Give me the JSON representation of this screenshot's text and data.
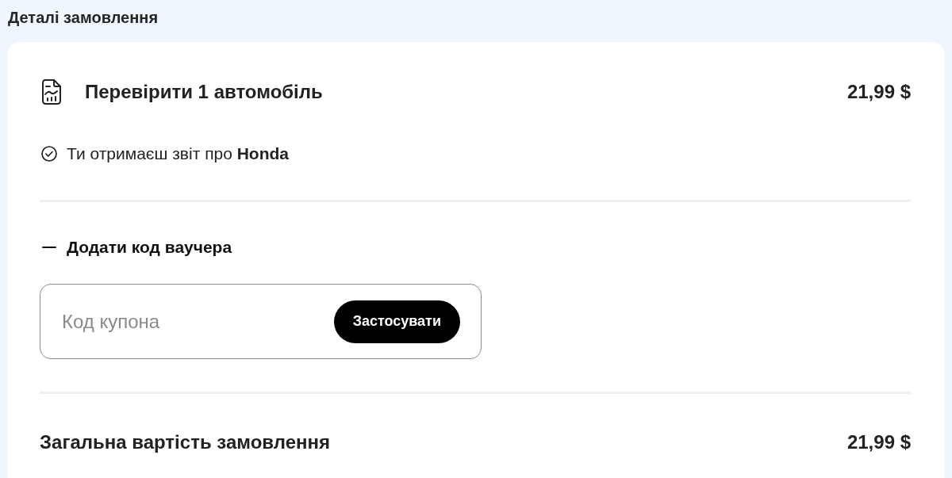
{
  "header": {
    "title": "Деталі замовлення"
  },
  "item": {
    "title": "Перевірити 1 автомобіль",
    "price": "21,99 $",
    "note": "Ти отримаєш звіт про **Honda**"
  },
  "voucher": {
    "label": "Додати код ваучера",
    "expanded": true,
    "placeholder": "Код купона",
    "button": "Застосувати"
  },
  "total": {
    "label": "Загальна вартість замовлення",
    "price": "21,99 $"
  }
}
